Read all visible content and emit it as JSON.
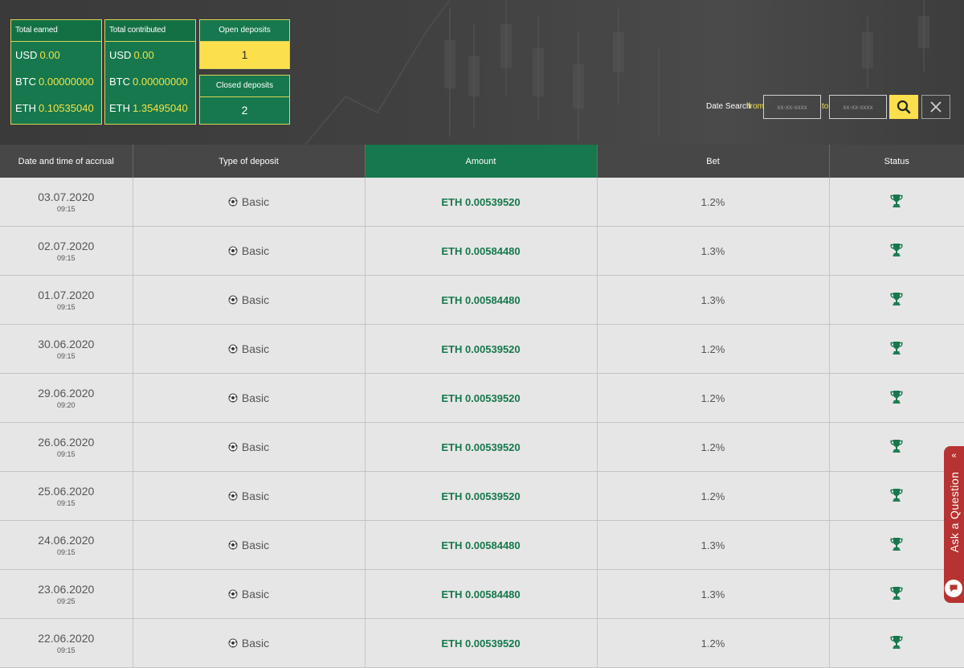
{
  "summary": {
    "total_earned": {
      "title": "Total earned",
      "rows": [
        {
          "currency": "USD",
          "value": "0.00"
        },
        {
          "currency": "BTC",
          "value": "0.00000000"
        },
        {
          "currency": "ETH",
          "value": "0.10535040"
        }
      ]
    },
    "total_contributed": {
      "title": "Total contributed",
      "rows": [
        {
          "currency": "USD",
          "value": "0.00"
        },
        {
          "currency": "BTC",
          "value": "0.00000000"
        },
        {
          "currency": "ETH",
          "value": "1.35495040"
        }
      ]
    },
    "open_deposits": {
      "label": "Open deposits",
      "count": "1"
    },
    "closed_deposits": {
      "label": "Closed deposits",
      "count": "2"
    }
  },
  "date_search": {
    "label": "Date Search",
    "from_label": "from",
    "to_label": "to",
    "from_placeholder": "xx-xx-xxxx",
    "to_placeholder": "xx-xx-xxxx",
    "search_icon": "search-icon",
    "clear_icon": "close-icon"
  },
  "table": {
    "headers": [
      "Date and time of accrual",
      "Type of deposit",
      "Amount",
      "Bet",
      "Status"
    ],
    "rows": [
      {
        "date": "03.07.2020",
        "time": "09:15",
        "type": "Basic",
        "amount": "ETH 0.00539520",
        "bet": "1.2%"
      },
      {
        "date": "02.07.2020",
        "time": "09:15",
        "type": "Basic",
        "amount": "ETH 0.00584480",
        "bet": "1.3%"
      },
      {
        "date": "01.07.2020",
        "time": "09:15",
        "type": "Basic",
        "amount": "ETH 0.00584480",
        "bet": "1.3%"
      },
      {
        "date": "30.06.2020",
        "time": "09:15",
        "type": "Basic",
        "amount": "ETH 0.00539520",
        "bet": "1.2%"
      },
      {
        "date": "29.06.2020",
        "time": "09:20",
        "type": "Basic",
        "amount": "ETH 0.00539520",
        "bet": "1.2%"
      },
      {
        "date": "26.06.2020",
        "time": "09:15",
        "type": "Basic",
        "amount": "ETH 0.00539520",
        "bet": "1.2%"
      },
      {
        "date": "25.06.2020",
        "time": "09:15",
        "type": "Basic",
        "amount": "ETH 0.00539520",
        "bet": "1.2%"
      },
      {
        "date": "24.06.2020",
        "time": "09:15",
        "type": "Basic",
        "amount": "ETH 0.00584480",
        "bet": "1.3%"
      },
      {
        "date": "23.06.2020",
        "time": "09:25",
        "type": "Basic",
        "amount": "ETH 0.00584480",
        "bet": "1.3%"
      },
      {
        "date": "22.06.2020",
        "time": "09:15",
        "type": "Basic",
        "amount": "ETH 0.00539520",
        "bet": "1.2%"
      }
    ],
    "type_icon": "soccer-ball-icon",
    "status_icon": "trophy-icon"
  },
  "ask_widget": {
    "label": "Ask a Question",
    "arrow": "«",
    "icon": "chat-bubble-icon"
  },
  "colors": {
    "accent_green": "#16784c",
    "accent_yellow": "#fcdf4c",
    "header_dark": "#474747",
    "widget_red": "#b63331"
  }
}
